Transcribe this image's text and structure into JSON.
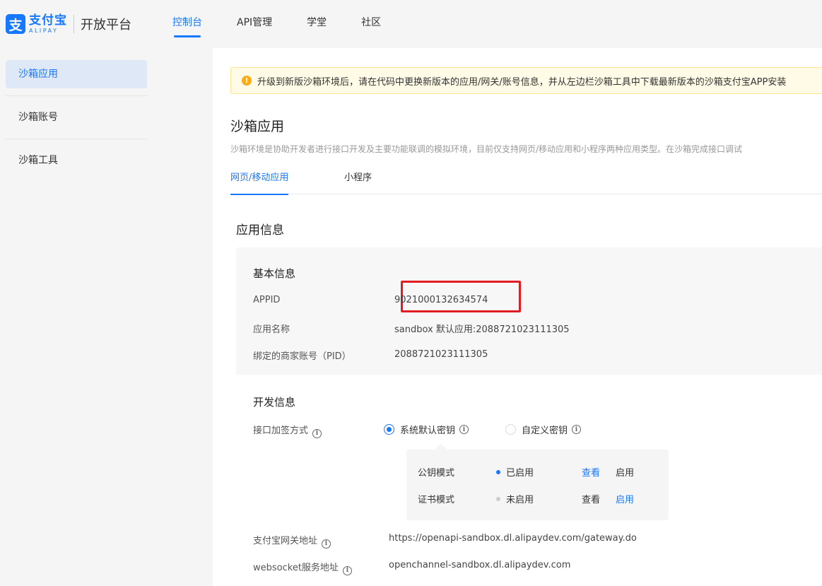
{
  "header": {
    "logo_cn": "支付宝",
    "logo_en": "ALIPAY",
    "logo_mark": "支",
    "platform": "开放平台",
    "nav": [
      {
        "label": "控制台",
        "active": true
      },
      {
        "label": "API管理",
        "active": false
      },
      {
        "label": "学堂",
        "active": false
      },
      {
        "label": "社区",
        "active": false
      }
    ]
  },
  "sidebar": {
    "items": [
      {
        "label": "沙箱应用",
        "active": true
      },
      {
        "label": "沙箱账号",
        "active": false
      },
      {
        "label": "沙箱工具",
        "active": false
      }
    ]
  },
  "alert": {
    "icon": "exclamation-icon",
    "text": "升级到新版沙箱环境后，请在代码中更换新版本的应用/网关/账号信息，并从左边栏沙箱工具中下载最新版本的沙箱支付宝APP安装"
  },
  "page": {
    "title": "沙箱应用",
    "description": "沙箱环境是协助开发者进行接口开发及主要功能联调的模拟环境，目前仅支持网页/移动应用和小程序两种应用类型。在沙箱完成接口调试"
  },
  "tabs": [
    {
      "label": "网页/移动应用",
      "active": true
    },
    {
      "label": "小程序",
      "active": false
    }
  ],
  "app_info": {
    "title": "应用信息",
    "basic": {
      "title": "基本信息",
      "rows": [
        {
          "label": "APPID",
          "value": "9021000132634574"
        },
        {
          "label": "应用名称",
          "value": "sandbox 默认应用:2088721023111305"
        },
        {
          "label": "绑定的商家账号（PID）",
          "value": "2088721023111305"
        }
      ]
    },
    "dev": {
      "title": "开发信息",
      "sign_label": "接口加签方式",
      "options": [
        {
          "label": "系统默认密钥",
          "selected": true
        },
        {
          "label": "自定义密钥",
          "selected": false
        }
      ],
      "key_modes": [
        {
          "mode": "公钥模式",
          "status": "已启用",
          "status_color": "#1677ff",
          "view": "查看",
          "enable": "启用"
        },
        {
          "mode": "证书模式",
          "status": "未启用",
          "status_color": "#cccccc",
          "view": "查看",
          "enable": "启用"
        }
      ],
      "gateway_label": "支付宝网关地址",
      "gateway_value": "https://openapi-sandbox.dl.alipaydev.com/gateway.do",
      "websocket_label": "websocket服务地址",
      "websocket_value": "openchannel-sandbox.dl.alipaydev.com"
    }
  },
  "colors": {
    "primary": "#1677ff",
    "highlight": "#e21c23",
    "alert_bg": "#fffbe6",
    "warn": "#faad14"
  }
}
